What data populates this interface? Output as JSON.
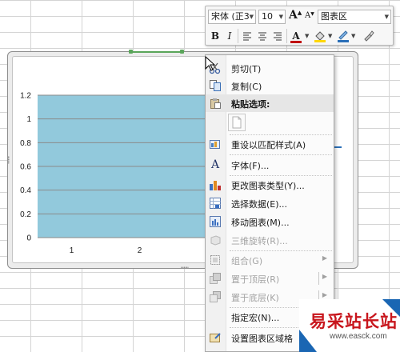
{
  "mini_toolbar": {
    "font_name": "宋体 (正3",
    "font_size": "10",
    "grow_font_label": "A",
    "shrink_font_label": "A",
    "element_selector": "图表区",
    "bold_label": "B",
    "italic_label": "I",
    "font_color_label": "A",
    "accent_red": "#c00000",
    "accent_yellow": "#ffd700"
  },
  "chart_data": {
    "type": "bar",
    "categories": [
      "1",
      "2"
    ],
    "values": [
      1.2,
      1.2
    ],
    "y_ticks": [
      "0",
      "0.2",
      "0.4",
      "0.6",
      "0.8",
      "1",
      "1.2"
    ],
    "ylim": [
      0,
      1.2
    ],
    "grid": true,
    "bar_color": "#92c9dc",
    "title": "",
    "xlabel": "",
    "ylabel": ""
  },
  "context_menu": {
    "items": [
      {
        "label": "剪切(T)",
        "icon": "scissors-icon",
        "disabled": false
      },
      {
        "label": "复制(C)",
        "icon": "copy-icon",
        "disabled": false
      },
      {
        "label": "粘贴选项:",
        "icon": "paste-icon",
        "disabled": false,
        "header": true
      },
      {
        "label": "重设以匹配样式(A)",
        "icon": "reset-style-icon",
        "disabled": false
      },
      {
        "label": "字体(F)...",
        "icon": "font-icon",
        "disabled": false
      },
      {
        "label": "更改图表类型(Y)...",
        "icon": "chart-type-icon",
        "disabled": false
      },
      {
        "label": "选择数据(E)...",
        "icon": "select-data-icon",
        "disabled": false
      },
      {
        "label": "移动图表(M)...",
        "icon": "move-chart-icon",
        "disabled": false
      },
      {
        "label": "三维旋转(R)...",
        "icon": "rotate-3d-icon",
        "disabled": true
      },
      {
        "label": "组合(G)",
        "icon": "group-icon",
        "disabled": true
      },
      {
        "label": "置于顶层(R)",
        "icon": "bring-front-icon",
        "disabled": true
      },
      {
        "label": "置于底层(K)",
        "icon": "send-back-icon",
        "disabled": true
      },
      {
        "label": "指定宏(N)...",
        "icon": "",
        "disabled": false
      },
      {
        "label": "设置图表区域格",
        "icon": "format-area-icon",
        "disabled": false
      }
    ],
    "paste_option_icon": "paste-keep-icon"
  },
  "watermark": {
    "text": "易采站长站",
    "url": "www.easck.com"
  }
}
